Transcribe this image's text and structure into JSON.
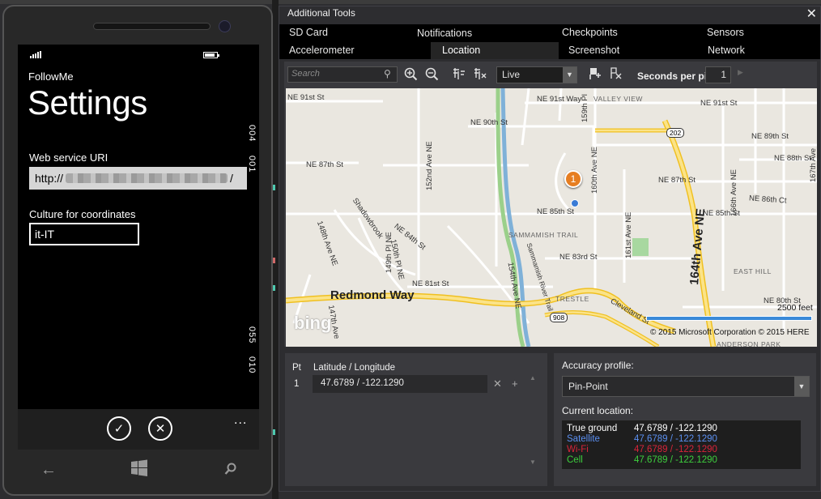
{
  "phone": {
    "app_name": "FollowMe",
    "page_title": "Settings",
    "uri_label": "Web service URI",
    "uri_value_visible": "http://",
    "uri_value_tail": "/",
    "culture_label": "Culture for coordinates",
    "culture_value": "it-IT",
    "side_ticks": [
      "004",
      "001",
      "055",
      "010"
    ],
    "appbar_more": "...",
    "colors": {
      "screen": "#000000",
      "text": "#ffffff"
    }
  },
  "tools": {
    "title": "Additional Tools",
    "close_glyph": "✕",
    "tabs": [
      {
        "label": "SD Card"
      },
      {
        "label": "Notifications"
      },
      {
        "label": "Checkpoints"
      },
      {
        "label": "Sensors"
      },
      {
        "label": "Accelerometer"
      },
      {
        "label": "Location",
        "active": true
      },
      {
        "label": "Screenshot"
      },
      {
        "label": "Network"
      }
    ],
    "toolbar": {
      "search_placeholder": "Search",
      "mode_value": "Live",
      "seconds_label": "Seconds per pin:",
      "seconds_value": "1"
    },
    "map": {
      "streets": [
        "NE 91st St",
        "NE 91st Way",
        "NE 91st St",
        "NE 90th St",
        "NE 89th St",
        "NE 88th St",
        "NE 87th St",
        "NE 87th St",
        "NE 86th Ct",
        "NE 85th St",
        "NE 85th St",
        "NE 84th St",
        "NE 83rd St",
        "NE 81st St",
        "NE 80th St",
        "159th Pl",
        "160th Ave NE",
        "161st Ave NE",
        "166th Ave NE",
        "167th Ave",
        "152nd Ave NE",
        "148th Ave NE",
        "149th Pl NE",
        "150th Pl NE",
        "154th Ave NE",
        "147th Ave",
        "Shadowbrook",
        "Sammamish River Trail",
        "Cleveland St",
        "Redmond Way",
        "164th Ave NE"
      ],
      "areas": [
        "VALLEY VIEW",
        "SAMMAMISH TRAIL",
        "TRESTLE",
        "EAST HILL",
        "ANDERSON PARK"
      ],
      "shields": [
        "202",
        "908"
      ],
      "pin_number": "1",
      "logo": "bing",
      "scale_label": "2500 feet",
      "copyright": "© 2015 Microsoft Corporation   © 2015 HERE"
    },
    "pins": {
      "col_pt": "Pt",
      "col_latlng": "Latitude / Longitude",
      "rows": [
        {
          "pt": "1",
          "latlng": "47.6789 / -122.1290"
        }
      ]
    },
    "accuracy": {
      "label": "Accuracy profile:",
      "value": "Pin-Point",
      "current_label": "Current location:",
      "rows": [
        {
          "name": "True ground",
          "value": "47.6789 / -122.1290",
          "color": "#ffffff"
        },
        {
          "name": "Satellite",
          "value": "47.6789 / -122.1290",
          "color": "#5b8ff0"
        },
        {
          "name": "Wi-Fi",
          "value": "47.6789 / -122.1290",
          "color": "#d8243a"
        },
        {
          "name": "Cell",
          "value": "47.6789 / -122.1290",
          "color": "#3dcf3d"
        }
      ]
    }
  }
}
